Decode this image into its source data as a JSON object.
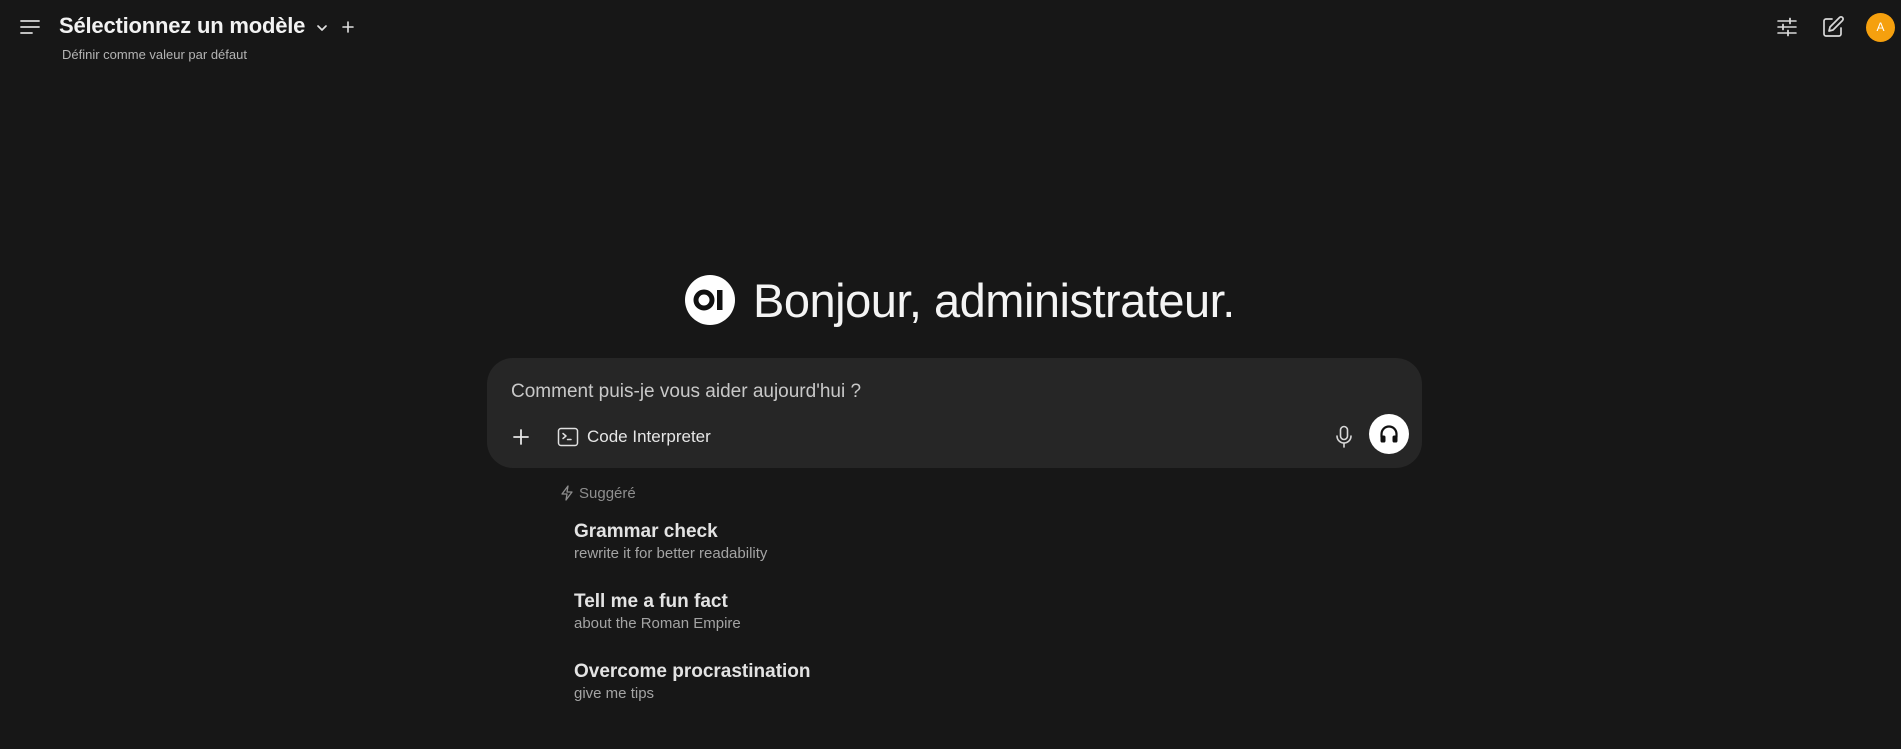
{
  "header": {
    "model_title": "Sélectionnez un modèle",
    "set_default": "Définir comme valeur par défaut",
    "avatar_initial": "A"
  },
  "greeting": {
    "logo_text": "OI",
    "text": "Bonjour, administrateur."
  },
  "chat": {
    "placeholder": "Comment puis-je vous aider aujourd'hui ?",
    "tool_label": "Code Interpreter"
  },
  "suggestions": {
    "heading": "Suggéré",
    "items": [
      {
        "title": "Grammar check",
        "subtitle": "rewrite it for better readability"
      },
      {
        "title": "Tell me a fun fact",
        "subtitle": "about the Roman Empire"
      },
      {
        "title": "Overcome procrastination",
        "subtitle": "give me tips"
      }
    ]
  },
  "icons": {
    "menu": "menu-icon",
    "chevron": "chevron-down-icon",
    "new_model": "plus-icon",
    "controls": "sliders-icon",
    "new_chat": "edit-icon",
    "attach": "plus-icon",
    "terminal": "terminal-icon",
    "mic": "microphone-icon",
    "voice": "headphones-icon",
    "suggested": "bolt-icon"
  },
  "colors": {
    "background": "#171717",
    "input_background": "#262626",
    "avatar": "#f5a00e"
  }
}
